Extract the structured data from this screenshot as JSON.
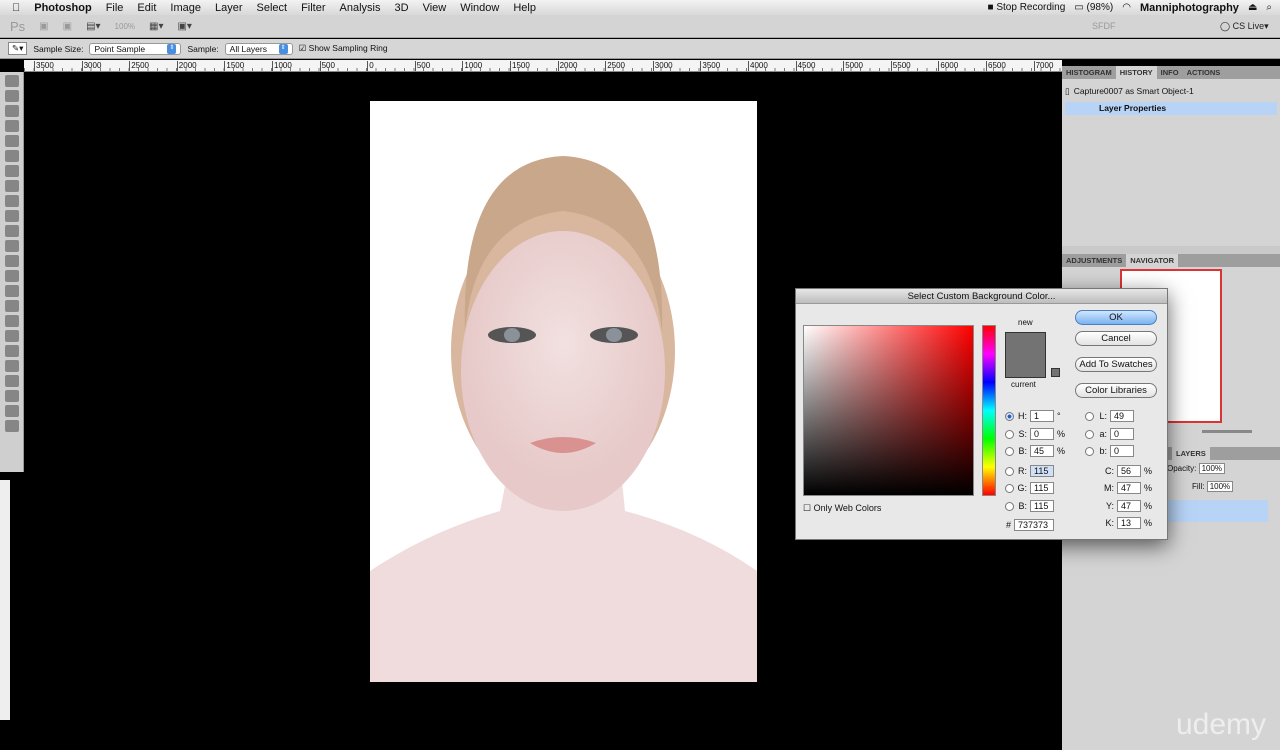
{
  "menubar": {
    "app": "Photoshop",
    "items": [
      "File",
      "Edit",
      "Image",
      "Layer",
      "Select",
      "Filter",
      "Analysis",
      "3D",
      "View",
      "Window",
      "Help"
    ],
    "status": {
      "recording": "Stop Recording",
      "battery": "(98%)",
      "user": "Manniphotography"
    }
  },
  "appbar": {
    "ps": "Ps",
    "zoom": "100%",
    "workspace": "SFDF",
    "cslive": "CS Live"
  },
  "options": {
    "sample_size_label": "Sample Size:",
    "sample_size": "Point Sample",
    "sample_label": "Sample:",
    "sample": "All Layers",
    "sampling_ring": "Show Sampling Ring"
  },
  "ruler": [
    "3500",
    "3000",
    "2500",
    "2000",
    "1500",
    "1000",
    "500",
    "0",
    "500",
    "1000",
    "1500",
    "2000",
    "2500",
    "3000",
    "3500",
    "4000",
    "4500",
    "5000",
    "5500",
    "6000",
    "6500",
    "7000"
  ],
  "panels": {
    "top_tabs": [
      "HISTOGRAM",
      "HISTORY",
      "INFO",
      "ACTIONS"
    ],
    "history": [
      "Capture0007 as Smart Object-1",
      "Layer Properties"
    ],
    "mid_tabs": [
      "ADJUSTMENTS",
      "NAVIGATOR"
    ],
    "layers_tab": "LAYERS",
    "opacity_label": "Opacity:",
    "opacity": "100%",
    "fill_label": "Fill:",
    "fill": "100%"
  },
  "dialog": {
    "title": "Select Custom Background Color...",
    "new_label": "new",
    "current_label": "current",
    "ok": "OK",
    "cancel": "Cancel",
    "add_swatches": "Add To Swatches",
    "libraries": "Color Libraries",
    "only_web": "Only Web Colors",
    "fields": {
      "H": "1",
      "S": "0",
      "B": "45",
      "R": "115",
      "G": "115",
      "Bl": "115",
      "L": "49",
      "a": "0",
      "b": "0",
      "C": "56",
      "M": "47",
      "Y": "47",
      "K": "13",
      "hex": "737373"
    },
    "units": {
      "deg": "°",
      "pct": "%"
    },
    "labels": {
      "H": "H:",
      "S": "S:",
      "B": "B:",
      "R": "R:",
      "G": "G:",
      "Bl": "B:",
      "L": "L:",
      "a": "a:",
      "b": "b:",
      "C": "C:",
      "M": "M:",
      "Y": "Y:",
      "K": "K:",
      "hex": "#"
    },
    "color": "#737373"
  },
  "watermark": "udemy"
}
